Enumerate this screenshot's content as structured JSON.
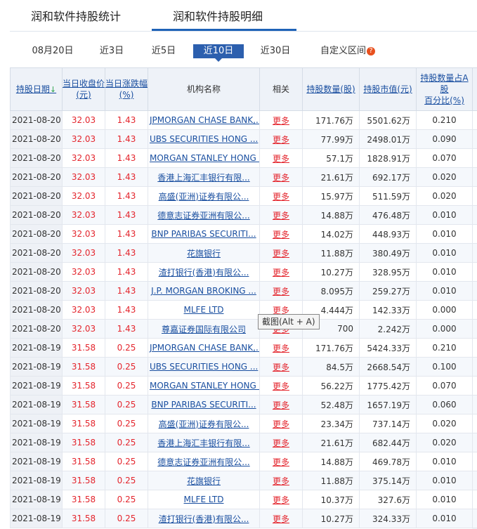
{
  "tabs": [
    "润和软件持股统计",
    "润和软件持股明细"
  ],
  "filters": [
    "08月20日",
    "近3日",
    "近5日",
    "近10日",
    "近30日",
    "自定义区间"
  ],
  "help_icon": "?",
  "headers": {
    "date": "持股日期",
    "close_line1": "当日收盘价",
    "close_line2": "(元)",
    "change_line1": "当日涨跌幅",
    "change_line2": "(%)",
    "org": "机构名称",
    "related": "相关",
    "qty": "持股数量(股)",
    "mv": "持股市值(元)",
    "pct_line1": "持股数量占A股",
    "pct_line2": "百分比(%)"
  },
  "sort_icon": "↓",
  "tooltip": "截图(Alt + A)",
  "rows": [
    [
      "2021-08-20",
      "32.03",
      "1.43",
      "JPMORGAN CHASE BANK,...",
      "更多",
      "171.76万",
      "5501.62万",
      "0.210"
    ],
    [
      "2021-08-20",
      "32.03",
      "1.43",
      "UBS SECURITIES HONG ...",
      "更多",
      "77.99万",
      "2498.01万",
      "0.090"
    ],
    [
      "2021-08-20",
      "32.03",
      "1.43",
      "MORGAN STANLEY HONG ...",
      "更多",
      "57.1万",
      "1828.91万",
      "0.070"
    ],
    [
      "2021-08-20",
      "32.03",
      "1.43",
      "香港上海汇丰银行有限...",
      "更多",
      "21.61万",
      "692.17万",
      "0.020"
    ],
    [
      "2021-08-20",
      "32.03",
      "1.43",
      "高盛(亚洲)证券有限公...",
      "更多",
      "15.97万",
      "511.59万",
      "0.020"
    ],
    [
      "2021-08-20",
      "32.03",
      "1.43",
      "德意志证券亚洲有限公...",
      "更多",
      "14.88万",
      "476.48万",
      "0.010"
    ],
    [
      "2021-08-20",
      "32.03",
      "1.43",
      "BNP PARIBAS SECURITI...",
      "更多",
      "14.02万",
      "448.93万",
      "0.010"
    ],
    [
      "2021-08-20",
      "32.03",
      "1.43",
      "花旗银行",
      "更多",
      "11.88万",
      "380.49万",
      "0.010"
    ],
    [
      "2021-08-20",
      "32.03",
      "1.43",
      "渣打银行(香港)有限公...",
      "更多",
      "10.27万",
      "328.95万",
      "0.010"
    ],
    [
      "2021-08-20",
      "32.03",
      "1.43",
      "J.P. MORGAN BROKING ...",
      "更多",
      "8.095万",
      "259.27万",
      "0.010"
    ],
    [
      "2021-08-20",
      "32.03",
      "1.43",
      "MLFE LTD",
      "更多",
      "4.444万",
      "142.33万",
      "0.000"
    ],
    [
      "2021-08-20",
      "32.03",
      "1.43",
      "尊嘉证券国际有限公司",
      "更多",
      "700",
      "2.242万",
      "0.000"
    ],
    [
      "2021-08-19",
      "31.58",
      "0.25",
      "JPMORGAN CHASE BANK,...",
      "更多",
      "171.76万",
      "5424.33万",
      "0.210"
    ],
    [
      "2021-08-19",
      "31.58",
      "0.25",
      "UBS SECURITIES HONG ...",
      "更多",
      "84.5万",
      "2668.54万",
      "0.100"
    ],
    [
      "2021-08-19",
      "31.58",
      "0.25",
      "MORGAN STANLEY HONG ...",
      "更多",
      "56.22万",
      "1775.42万",
      "0.070"
    ],
    [
      "2021-08-19",
      "31.58",
      "0.25",
      "BNP PARIBAS SECURITI...",
      "更多",
      "52.48万",
      "1657.19万",
      "0.060"
    ],
    [
      "2021-08-19",
      "31.58",
      "0.25",
      "高盛(亚洲)证券有限公...",
      "更多",
      "23.34万",
      "737.14万",
      "0.020"
    ],
    [
      "2021-08-19",
      "31.58",
      "0.25",
      "香港上海汇丰银行有限...",
      "更多",
      "21.61万",
      "682.44万",
      "0.020"
    ],
    [
      "2021-08-19",
      "31.58",
      "0.25",
      "德意志证券亚洲有限公...",
      "更多",
      "14.88万",
      "469.78万",
      "0.010"
    ],
    [
      "2021-08-19",
      "31.58",
      "0.25",
      "花旗银行",
      "更多",
      "11.88万",
      "375.14万",
      "0.010"
    ],
    [
      "2021-08-19",
      "31.58",
      "0.25",
      "MLFE LTD",
      "更多",
      "10.37万",
      "327.6万",
      "0.010"
    ],
    [
      "2021-08-19",
      "31.58",
      "0.25",
      "渣打银行(香港)有限公...",
      "更多",
      "10.27万",
      "324.33万",
      "0.010"
    ]
  ]
}
